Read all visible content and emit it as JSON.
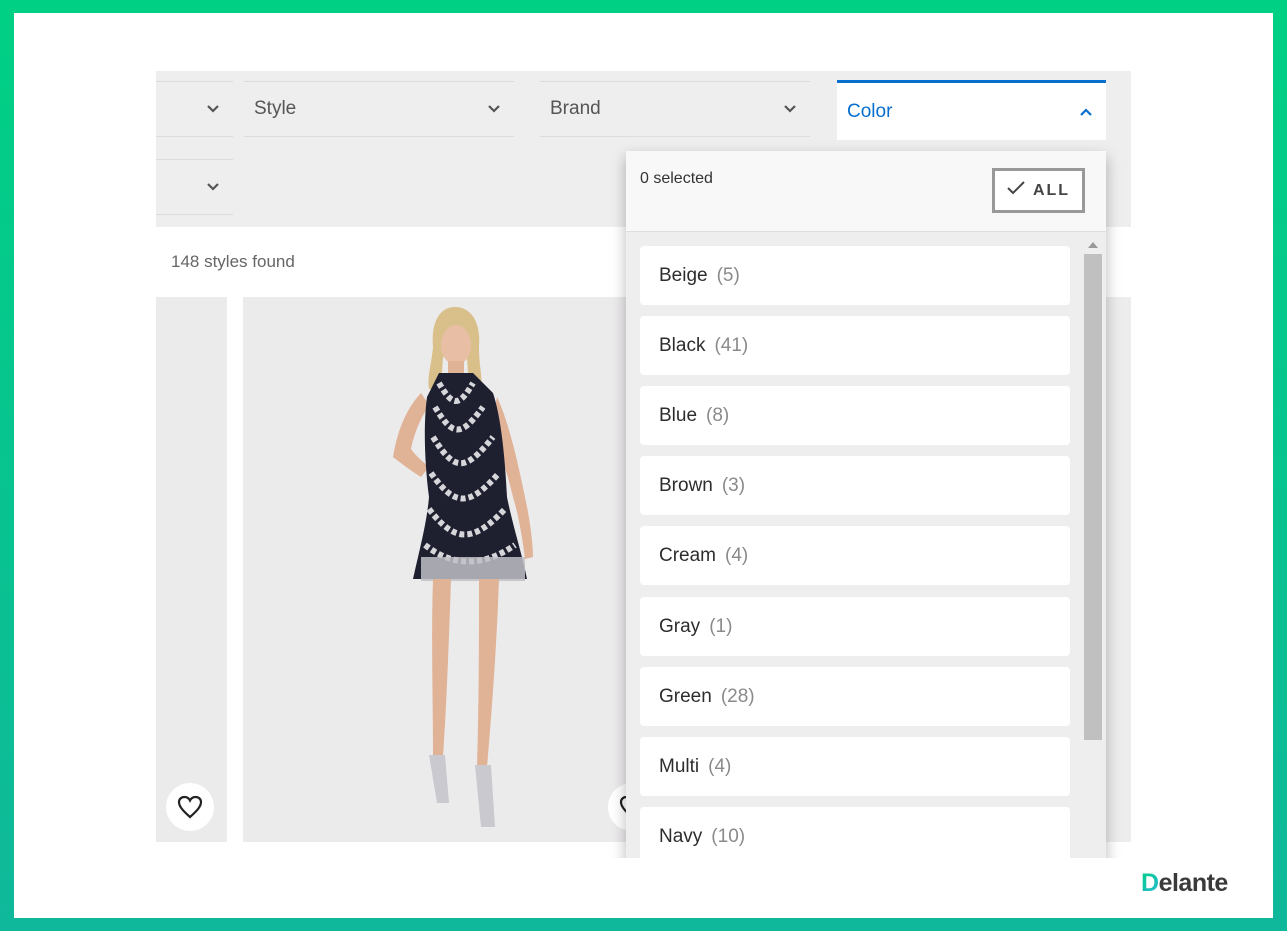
{
  "filters": {
    "row1": [
      {
        "label": ""
      },
      {
        "label": "Style"
      },
      {
        "label": "Brand"
      },
      {
        "label": "Color"
      }
    ],
    "row2": [
      {
        "label": ""
      }
    ]
  },
  "results": {
    "count_text": "148 styles found"
  },
  "color_panel": {
    "selected_text": "0 selected",
    "all_label": "ALL",
    "options": [
      {
        "name": "Beige",
        "count": "(5)"
      },
      {
        "name": "Black",
        "count": "(41)"
      },
      {
        "name": "Blue",
        "count": "(8)"
      },
      {
        "name": "Brown",
        "count": "(3)"
      },
      {
        "name": "Cream",
        "count": "(4)"
      },
      {
        "name": "Gray",
        "count": "(1)"
      },
      {
        "name": "Green",
        "count": "(28)"
      },
      {
        "name": "Multi",
        "count": "(4)"
      },
      {
        "name": "Navy",
        "count": "(10)"
      }
    ]
  },
  "brand_logo": {
    "first_letter": "D",
    "rest": "elante"
  },
  "colors": {
    "frame_green": "#00d084",
    "active_blue": "#0770cf"
  }
}
